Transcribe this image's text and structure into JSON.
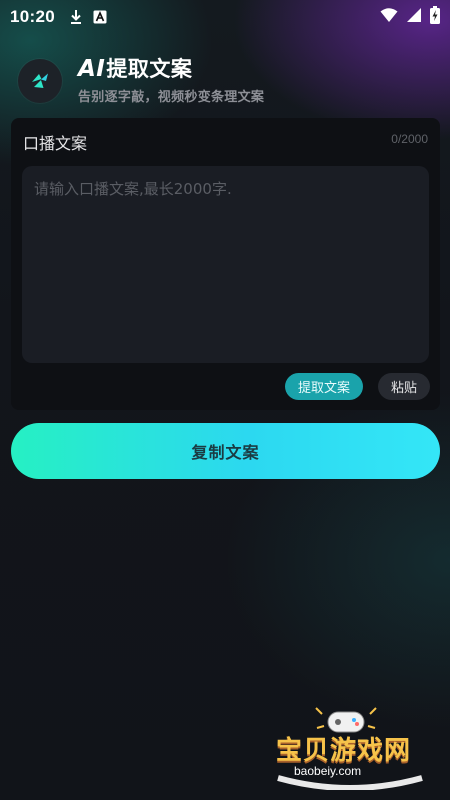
{
  "status_bar": {
    "time": "10:20",
    "icons": [
      "download-icon",
      "a-badge-icon",
      "wifi-icon",
      "signal-icon",
      "battery-charging-icon"
    ]
  },
  "header": {
    "logo_icon": "ai-logo-icon",
    "title_ai": "AI",
    "title_rest": "提取文案",
    "subtitle": "告别逐字敲，视频秒变条理文案"
  },
  "card": {
    "label": "口播文案",
    "counter": "0/2000",
    "textarea_value": "",
    "textarea_placeholder": "请输入口播文案,最长2000字.",
    "extract_button": "提取文案",
    "paste_button": "粘贴"
  },
  "copy_button": "复制文案",
  "watermark": {
    "text": "宝贝游戏网",
    "url": "baobeiy.com"
  },
  "colors": {
    "accent_teal": "#1aa3ab",
    "button_gradient_start": "#26f0c3",
    "button_gradient_end": "#34e6f7",
    "background": "#111318"
  }
}
